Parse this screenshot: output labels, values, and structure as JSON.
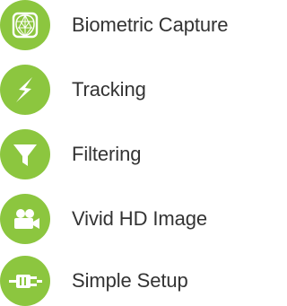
{
  "theme": {
    "accent": "#8cc63f",
    "text": "#333333",
    "icon_fg": "#ffffff"
  },
  "features": [
    {
      "label": "Biometric Capture",
      "icon": "face-scan-icon"
    },
    {
      "label": "Tracking",
      "icon": "lightning-icon"
    },
    {
      "label": "Filtering",
      "icon": "funnel-icon"
    },
    {
      "label": "Vivid HD Image",
      "icon": "video-camera-icon"
    },
    {
      "label": "Simple Setup",
      "icon": "plug-icon"
    }
  ]
}
